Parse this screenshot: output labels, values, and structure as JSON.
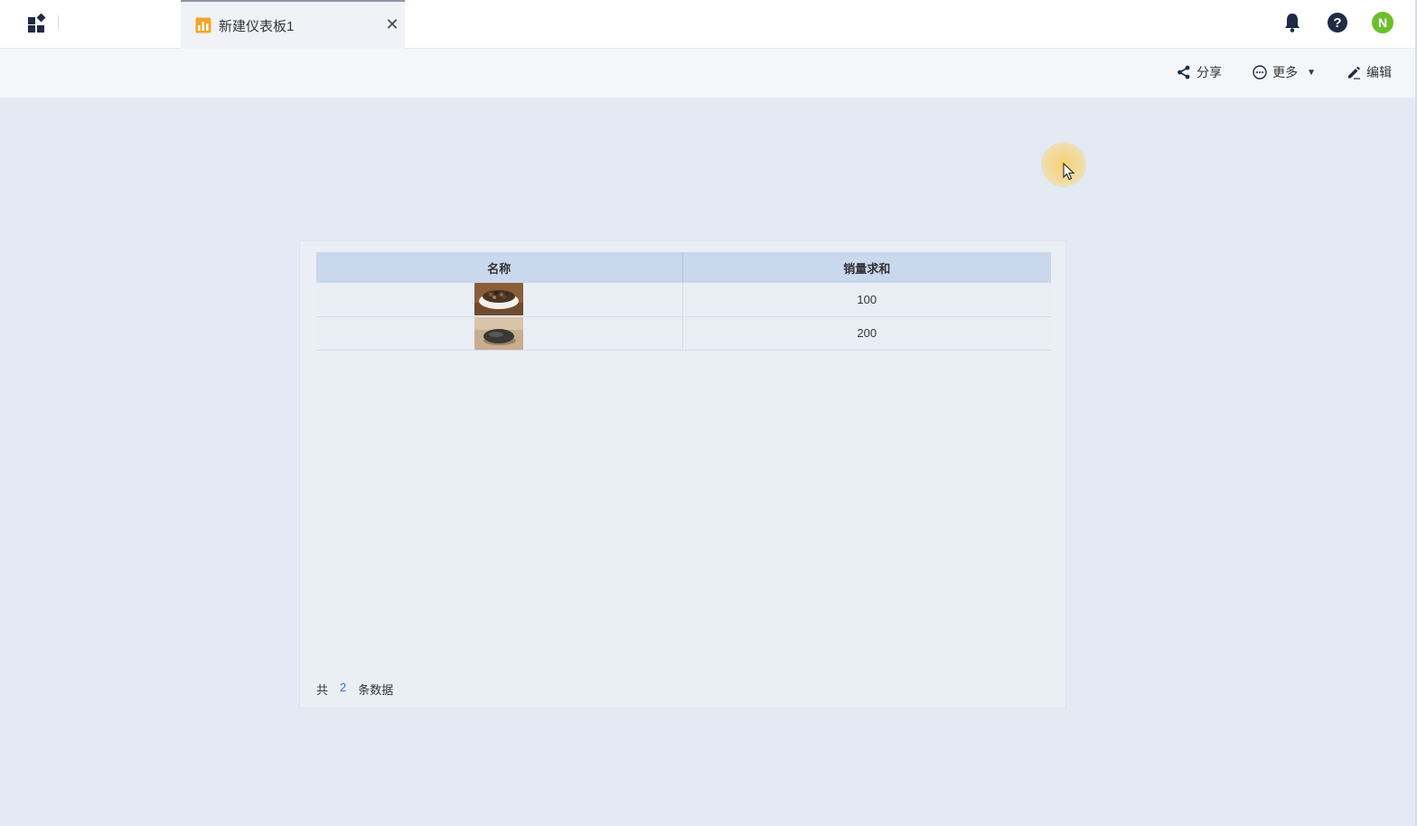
{
  "topbar": {
    "tab_title": "新建仪表板1",
    "close_glyph": "✕",
    "icons": [
      "apps-grid-icon",
      "bell-icon",
      "help-icon"
    ],
    "avatar_letter": "N",
    "avatar_color": "#6cbf2b"
  },
  "toolbar": {
    "share_label": "分享",
    "more_label": "更多",
    "edit_label": "编辑"
  },
  "table": {
    "columns": [
      "名称",
      "销量求和"
    ],
    "rows": [
      {
        "name_image": "coffee-beans-bowl-thumbnail",
        "value": "100"
      },
      {
        "name_image": "computer-mouse-thumbnail",
        "value": "200"
      }
    ]
  },
  "footer": {
    "prefix": "共",
    "count": "2",
    "suffix": "条数据"
  },
  "colors": {
    "tab_icon": "#f5a524",
    "header_bg": "#c9d8ec",
    "count_link": "#3a6fd8"
  }
}
